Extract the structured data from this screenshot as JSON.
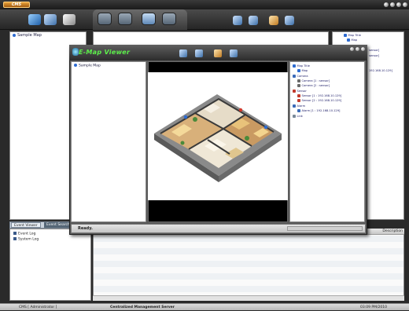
{
  "app": {
    "logo_text": "CMS"
  },
  "main_tree": {
    "item": "Sample Map"
  },
  "right_tree_back": {
    "map_title": "Map Title",
    "map": "Map",
    "ip_a": "sensor]",
    "ip_b": "sensor]",
    "ip_c": "192.168.10.129]"
  },
  "bottom": {
    "tabs": [
      "Event Viewer",
      "Event Search"
    ],
    "tree": [
      "Event Log",
      "System Log"
    ],
    "table_header": "Description"
  },
  "status_bar": {
    "user": "CMS [ Administrator ]",
    "server": "Centralized Management Server",
    "clock": "03:09 PM/2010"
  },
  "emap": {
    "title": "E-Map Viewer",
    "left_item": "Sample Map",
    "status": "Ready.",
    "tree": {
      "map_title": "Map Title",
      "map": "Map",
      "camera": "Camera",
      "camera_1": "Camera [1 : sensor]",
      "camera_2": "Camera [2 : sensor]",
      "sensor": "Sensor",
      "sensor_1": "Sensor [1 : 192.168.10.129]",
      "sensor_2": "Sensor [2 : 192.168.10.129]",
      "alarm": "Alarm",
      "alarm_1": "Alarm [1 : 192.168.10.129]",
      "link": "Link"
    }
  },
  "colors": {
    "accent_green": "#5cf04a",
    "titlebar": "#2c2c2c",
    "tree_text": "#1a1a66"
  }
}
